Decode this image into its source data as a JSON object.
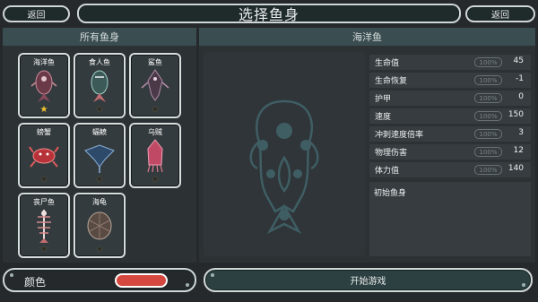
{
  "header": {
    "title": "选择鱼身",
    "back_left": "返回",
    "back_right": "返回"
  },
  "left_panel": {
    "title": "所有鱼身",
    "cards": [
      {
        "name": "海洋鱼",
        "icon": "ocean-fish-icon",
        "star": "gold"
      },
      {
        "name": "食人鱼",
        "icon": "piranha-icon",
        "star": "dim"
      },
      {
        "name": "鲨鱼",
        "icon": "shark-icon",
        "star": "dim"
      },
      {
        "name": "螃蟹",
        "icon": "crab-icon",
        "star": "dim"
      },
      {
        "name": "蝠鲼",
        "icon": "manta-ray-icon",
        "star": "dim"
      },
      {
        "name": "乌贼",
        "icon": "squid-icon",
        "star": "dim"
      },
      {
        "name": "丧尸鱼",
        "icon": "zombie-fish-icon",
        "star": "dim"
      },
      {
        "name": "海龟",
        "icon": "sea-turtle-icon",
        "star": "dim"
      }
    ],
    "star_glyph": "★"
  },
  "right_panel": {
    "title": "海洋鱼",
    "stats": [
      {
        "label": "生命值",
        "pct": "100%",
        "value": "45"
      },
      {
        "label": "生命恢复",
        "pct": "100%",
        "value": "-1"
      },
      {
        "label": "护甲",
        "pct": "100%",
        "value": "0"
      },
      {
        "label": "速度",
        "pct": "100%",
        "value": "150"
      },
      {
        "label": "冲刺速度倍率",
        "pct": "100%",
        "value": "3"
      },
      {
        "label": "物理伤害",
        "pct": "100%",
        "value": "12"
      },
      {
        "label": "体力值",
        "pct": "100%",
        "value": "140"
      }
    ],
    "description": "初始鱼身"
  },
  "footer": {
    "color_label": "颜色",
    "color_value": "#d4483f",
    "start_label": "开始游戏"
  }
}
